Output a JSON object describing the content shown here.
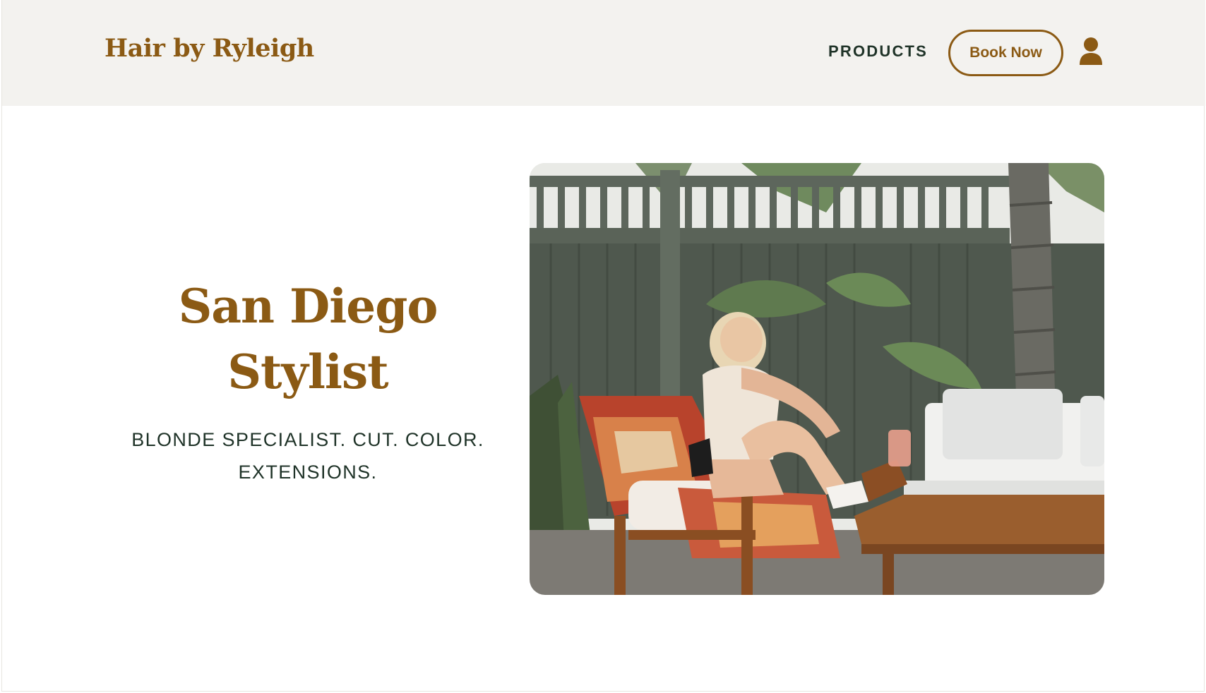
{
  "header": {
    "logo": "Hair by Ryleigh",
    "nav": {
      "products_label": "PRODUCTS"
    },
    "book_label": "Book Now",
    "account_icon": "user-icon"
  },
  "hero": {
    "title_line1": "San Diego",
    "title_line2": "Stylist",
    "subtitle_line1": "BLONDE SPECIALIST. CUT. COLOR.",
    "subtitle_line2": "EXTENSIONS.",
    "image": "woman-seated-in-garden-chair-photo"
  },
  "colors": {
    "brand_brown": "#8b5a14",
    "dark_green_text": "#1f3328",
    "header_bg": "#f3f2ef"
  }
}
